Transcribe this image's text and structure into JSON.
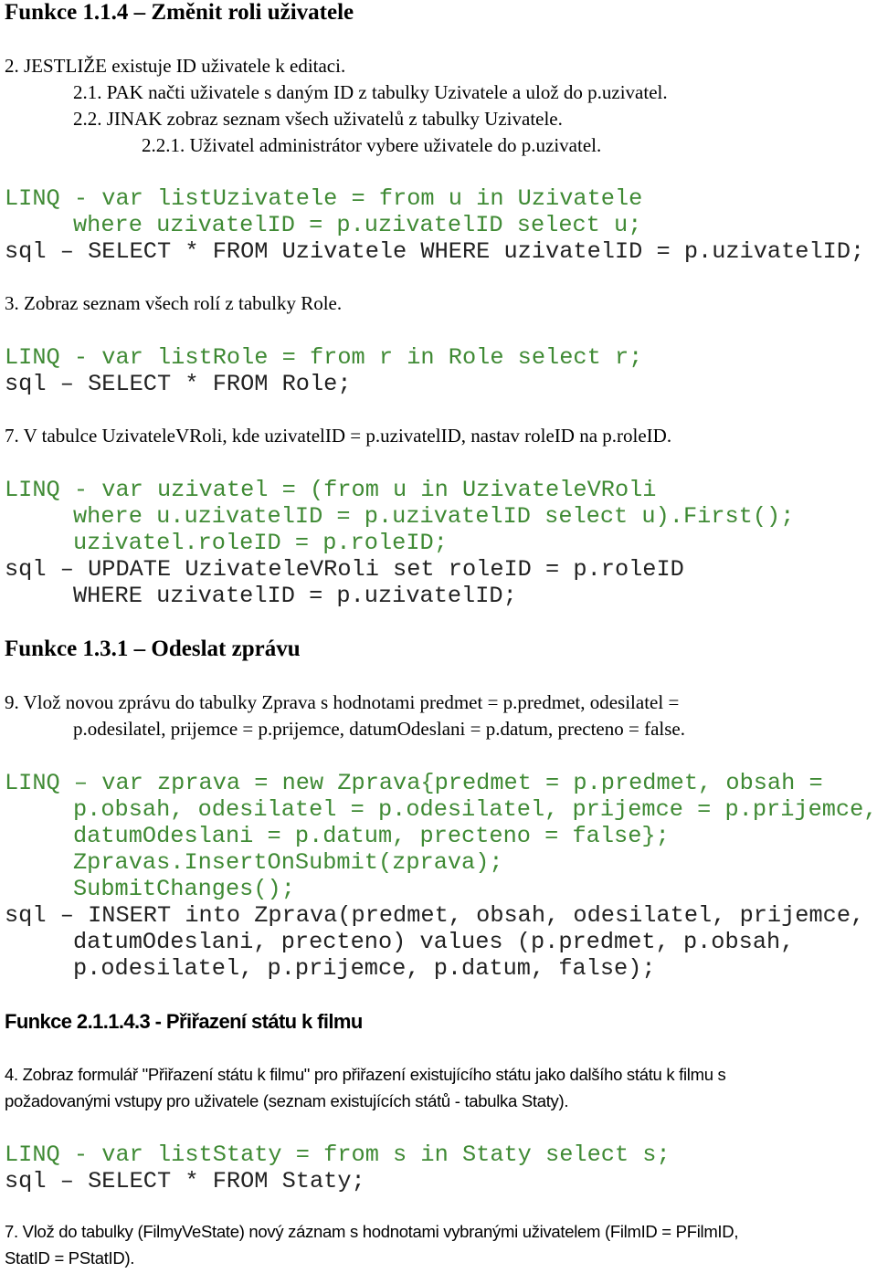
{
  "sections": [
    {
      "heading": "Funkce 1.1.4 – Změnit roli uživatele",
      "steps": [
        "2. JESTLIŽE existuje ID uživatele k editaci.",
        "2.1. PAK načti uživatele s daným ID z tabulky Uzivatele a ulož do p.uzivatel.",
        "2.2. JINAK zobraz seznam všech uživatelů z tabulky Uzivatele.",
        "2.2.1. Uživatel administrátor vybere uživatele do p.uzivatel."
      ],
      "code1": {
        "linq": [
          "LINQ - var listUzivatele = from u in Uzivatele",
          "where uzivatelID = p.uzivatelID select u;"
        ],
        "sql": [
          "sql – SELECT * FROM Uzivatele WHERE uzivatelID = p.uzivatelID;"
        ]
      },
      "step3": "3. Zobraz seznam všech rolí z tabulky Role.",
      "code2": {
        "linq": [
          "LINQ - var listRole = from r in Role select r;"
        ],
        "sql": [
          "sql – SELECT * FROM Role;"
        ]
      },
      "step7": "7. V tabulce UzivateleVRoli, kde uzivatelID = p.uzivatelID, nastav roleID na p.roleID.",
      "code3": {
        "linq": [
          "LINQ - var uzivatel = (from u in UzivateleVRoli",
          "where u.uzivatelID = p.uzivatelID select u).First();",
          "uzivatel.roleID = p.roleID;"
        ],
        "sql": [
          "sql – UPDATE UzivateleVRoli set roleID = p.roleID",
          "WHERE uzivatelID = p.uzivatelID;"
        ]
      }
    },
    {
      "heading": "Funkce 1.3.1 – Odeslat zprávu",
      "step9": [
        "9. Vlož novou zprávu do tabulky Zprava s hodnotami predmet = p.predmet, odesilatel =",
        "p.odesilatel, prijemce = p.prijemce, datumOdeslani = p.datum, precteno = false."
      ],
      "code": {
        "linq": [
          "LINQ – var zprava = new Zprava{predmet = p.predmet, obsah =",
          "p.obsah, odesilatel = p.odesilatel, prijemce = p.prijemce,",
          "datumOdeslani = p.datum, precteno = false};",
          "Zpravas.InsertOnSubmit(zprava);",
          "SubmitChanges();"
        ],
        "sql": [
          "sql – INSERT into Zprava(predmet, obsah, odesilatel, prijemce,",
          "datumOdeslani, precteno) values (p.predmet, p.obsah,",
          "p.odesilatel, p.prijemce, p.datum, false);"
        ]
      }
    },
    {
      "heading": "Funkce 2.1.1.4.3 - Přiřazení státu k filmu",
      "step4": [
        "4. Zobraz formulář \"Přiřazení státu k filmu\" pro přiřazení existujícího státu jako dalšího státu k filmu s",
        "požadovanými vstupy pro uživatele (seznam existujících států - tabulka Staty)."
      ],
      "code": {
        "linq": [
          "LINQ - var listStaty = from s in Staty select s;"
        ],
        "sql": [
          "sql – SELECT * FROM Staty;"
        ]
      },
      "step7": [
        "7. Vlož do tabulky (FilmyVeState) nový záznam s hodnotami vybranými uživatelem (FilmID = PFilmID,",
        "StatID = PStatID)."
      ]
    }
  ],
  "colors": {
    "linq": "#3f8a34",
    "sql": "#222222"
  }
}
